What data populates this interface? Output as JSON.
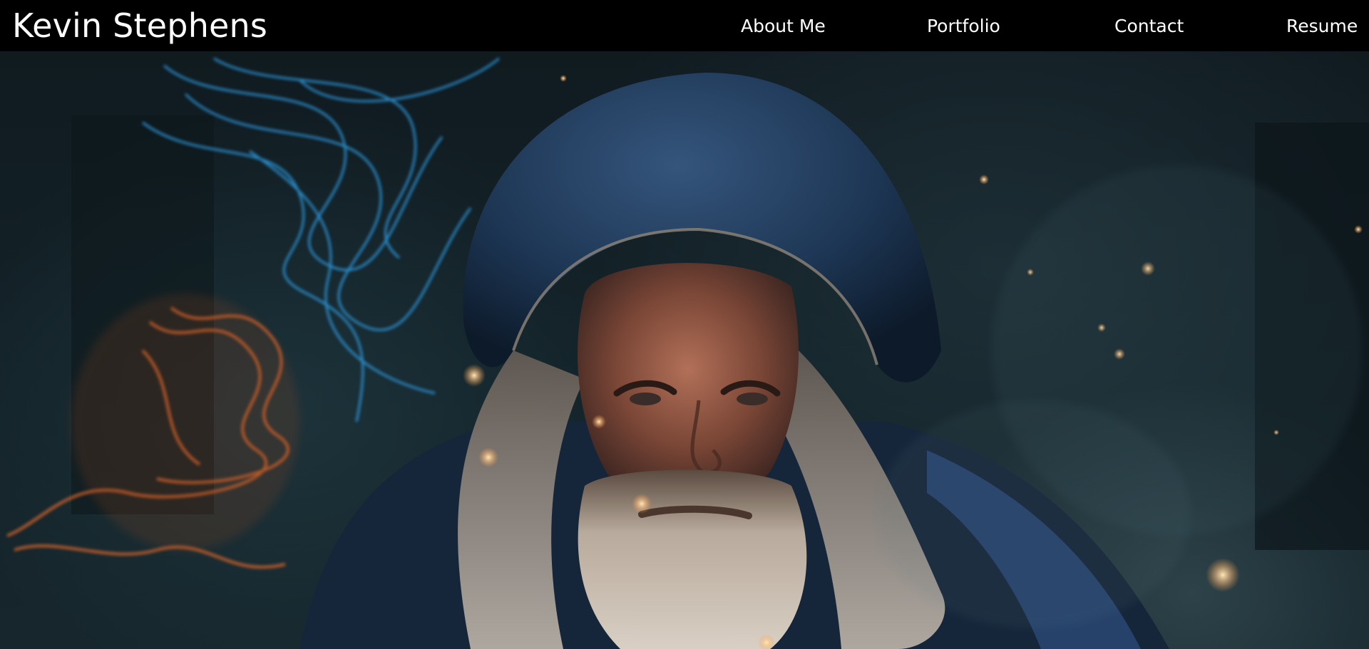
{
  "header": {
    "brand": "Kevin Stephens",
    "nav": [
      {
        "label": "About Me"
      },
      {
        "label": "Portfolio"
      },
      {
        "label": "Contact"
      },
      {
        "label": "Resume"
      }
    ]
  },
  "hero": {
    "image_icon": "wizard-portrait-image",
    "colors": {
      "robe": "#1f3a5c",
      "magic_blue": "#2e9be0",
      "magic_orange": "#d0602a",
      "background": "#122026"
    }
  }
}
